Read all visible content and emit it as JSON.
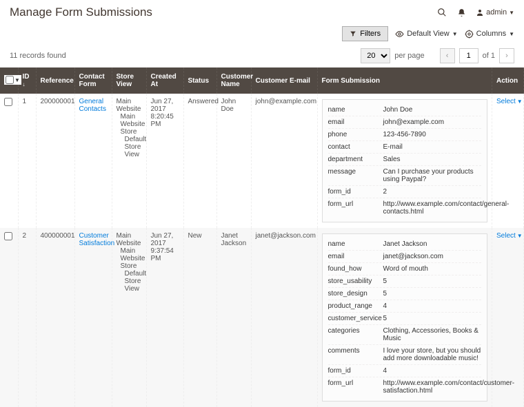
{
  "header": {
    "title": "Manage Form Submissions",
    "user": "admin"
  },
  "toolbar": {
    "filters": "Filters",
    "defaultView": "Default View",
    "columns": "Columns"
  },
  "records": {
    "found": "11 records found",
    "perpage_value": "20",
    "perpage_label": "per page",
    "page": "1",
    "of": "of 1"
  },
  "cols": {
    "id": "ID",
    "ref": "Reference",
    "form": "Contact Form",
    "store": "Store View",
    "created": "Created At",
    "status": "Status",
    "cname": "Customer Name",
    "cemail": "Customer E-mail",
    "submission": "Form Submission",
    "action": "Action"
  },
  "rows": [
    {
      "id": "1",
      "ref": "200000001",
      "form": "General Contacts",
      "store": "Main Website\n  Main Website Store\n    Default Store View",
      "created": "Jun 27, 2017 8:20:45 PM",
      "status": "Answered",
      "cname": "John Doe",
      "cemail": "john@example.com",
      "action": "Select",
      "sub": [
        [
          "name",
          "John Doe"
        ],
        [
          "email",
          "john@example.com"
        ],
        [
          "phone",
          "123-456-7890"
        ],
        [
          "contact",
          "E-mail"
        ],
        [
          "department",
          "Sales"
        ],
        [
          "message",
          "Can I purchase your products using Paypal?"
        ],
        [
          "form_id",
          "2"
        ],
        [
          "form_url",
          "http://www.example.com/contact/general-contacts.html"
        ]
      ]
    },
    {
      "id": "2",
      "ref": "400000001",
      "form": "Customer Satisfaction",
      "store": "Main Website\n  Main Website Store\n    Default Store View",
      "created": "Jun 27, 2017 9:37:54 PM",
      "status": "New",
      "cname": "Janet Jackson",
      "cemail": "janet@jackson.com",
      "action": "Select",
      "sub": [
        [
          "name",
          "Janet Jackson"
        ],
        [
          "email",
          "janet@jackson.com"
        ],
        [
          "found_how",
          "Word of mouth"
        ],
        [
          "store_usability",
          "5"
        ],
        [
          "store_design",
          "5"
        ],
        [
          "product_range",
          "4"
        ],
        [
          "customer_service",
          "5"
        ],
        [
          "categories",
          "Clothing, Accessories, Books & Music"
        ],
        [
          "comments",
          "I love your store, but you should add more downloadable music!"
        ],
        [
          "form_id",
          "4"
        ],
        [
          "form_url",
          "http://www.example.com/contact/customer-satisfaction.html"
        ]
      ]
    }
  ]
}
